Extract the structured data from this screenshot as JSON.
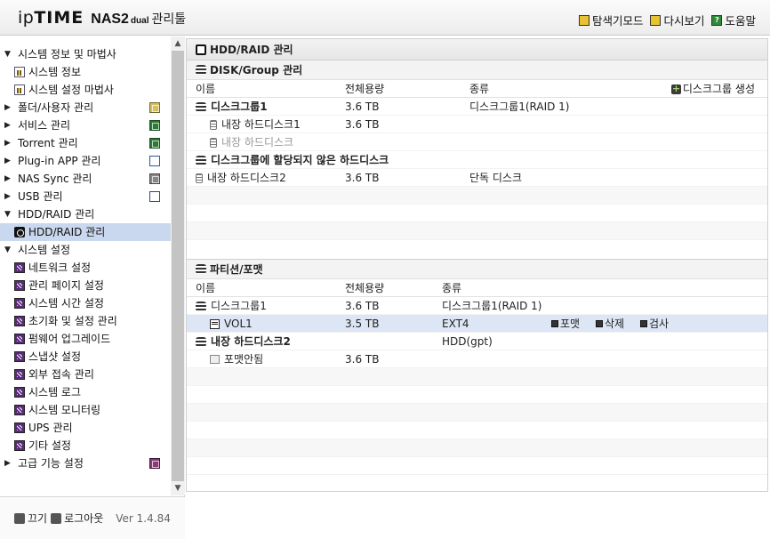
{
  "header": {
    "logo_prefix": "ip",
    "logo_bold": "TIME",
    "model": "NAS2",
    "model_suffix": "dual",
    "tool": "관리툴",
    "links": [
      {
        "label": "탐색기모드",
        "icon": "explorer-icon"
      },
      {
        "label": "다시보기",
        "icon": "refresh-icon"
      },
      {
        "label": "도움말",
        "icon": "help-icon"
      }
    ]
  },
  "sidebar": {
    "nodes": [
      {
        "label": "시스템 정보 및 마법사",
        "arrow": "▼"
      },
      {
        "label": "시스템 정보"
      },
      {
        "label": "시스템 설정 마법사"
      },
      {
        "label": "폴더/사용자 관리",
        "arrow": "▶"
      },
      {
        "label": "서비스 관리",
        "arrow": "▶"
      },
      {
        "label": "Torrent 관리",
        "arrow": "▶"
      },
      {
        "label": "Plug-in APP 관리",
        "arrow": "▶"
      },
      {
        "label": "NAS Sync 관리",
        "arrow": "▶"
      },
      {
        "label": "USB 관리",
        "arrow": "▶"
      },
      {
        "label": "HDD/RAID 관리",
        "arrow": "▼"
      },
      {
        "label": "HDD/RAID 관리"
      },
      {
        "label": "시스템 설정",
        "arrow": "▼"
      },
      {
        "label": "네트워크 설정"
      },
      {
        "label": "관리 페이지 설정"
      },
      {
        "label": "시스템 시간 설정"
      },
      {
        "label": "초기화 및 설정 관리"
      },
      {
        "label": "펌웨어 업그레이드"
      },
      {
        "label": "스냅샷 설정"
      },
      {
        "label": "외부 접속 관리"
      },
      {
        "label": "시스템 로그"
      },
      {
        "label": "시스템 모니터링"
      },
      {
        "label": "UPS 관리"
      },
      {
        "label": "기타 설정"
      },
      {
        "label": "고급 기능 설정",
        "arrow": "▶"
      }
    ],
    "scroll_up": "▲",
    "scroll_down": "▼",
    "footer": {
      "power_label": "끄기",
      "logout_label": "로그아웃",
      "version": "Ver 1.4.84"
    }
  },
  "main": {
    "title": "HDD/RAID 관리",
    "disk_section": {
      "title": "DISK/Group 관리",
      "columns": [
        "이름",
        "전체용량",
        "종류"
      ],
      "create_label": "디스크그룹 생성",
      "rows": [
        {
          "name": "디스크그룹1",
          "capacity": "3.6 TB",
          "type": "디스크그룹1(RAID 1)"
        },
        {
          "name": "내장 하드디스크1",
          "capacity": "3.6 TB",
          "type": ""
        },
        {
          "name": "내장 하드디스크",
          "capacity": "",
          "type": ""
        },
        {
          "name": "디스크그룹에 할당되지 않은 하드디스크",
          "capacity": "",
          "type": ""
        },
        {
          "name": "내장 하드디스크2",
          "capacity": "3.6 TB",
          "type": "단독 디스크"
        }
      ]
    },
    "partition_section": {
      "title": "파티션/포맷",
      "columns": [
        "이름",
        "전체용량",
        "종류"
      ],
      "rows": [
        {
          "name": "디스크그룹1",
          "capacity": "3.6 TB",
          "type": "디스크그룹1(RAID 1)"
        },
        {
          "name": "VOL1",
          "capacity": "3.5 TB",
          "type": "EXT4"
        },
        {
          "name": "내장 하드디스크2",
          "capacity": "",
          "type": "HDD(gpt)"
        },
        {
          "name": "포맷안됨",
          "capacity": "3.6 TB",
          "type": ""
        }
      ],
      "actions": {
        "format": "포맷",
        "delete": "삭제",
        "check": "검사"
      }
    }
  }
}
